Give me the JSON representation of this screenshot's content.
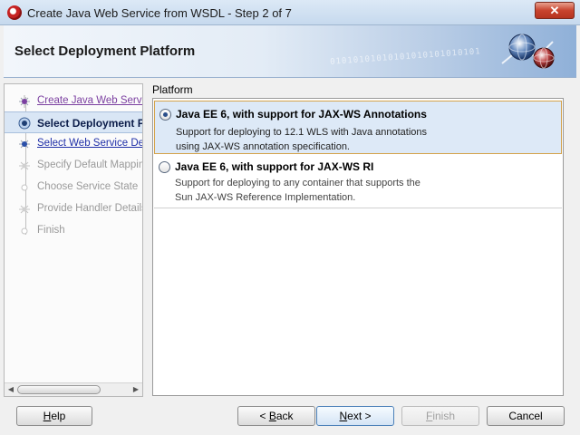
{
  "window": {
    "title": "Create Java Web Service from WSDL - Step 2 of 7",
    "close_label": "✕"
  },
  "header": {
    "title": "Select Deployment Platform",
    "binary_text": "01010101010101010101010101"
  },
  "steps": [
    {
      "label": "Create Java Web Servic",
      "state": "visited"
    },
    {
      "label": "Select Deployment P",
      "state": "current"
    },
    {
      "label": "Select Web Service Desc",
      "state": "link"
    },
    {
      "label": "Specify Default Mapping",
      "state": "disabled"
    },
    {
      "label": "Choose Service State",
      "state": "disabled"
    },
    {
      "label": "Provide Handler Details",
      "state": "disabled"
    },
    {
      "label": "Finish",
      "state": "disabled"
    }
  ],
  "platform": {
    "label": "Platform",
    "options": [
      {
        "title": "Java EE 6, with support for JAX-WS Annotations",
        "desc_line1": "Support for deploying to 12.1 WLS with Java annotations",
        "desc_line2": "using JAX-WS annotation specification.",
        "selected": true
      },
      {
        "title": "Java EE 6, with support for JAX-WS RI",
        "desc_line1": "Support for deploying to any container that supports the",
        "desc_line2": "Sun JAX-WS Reference Implementation.",
        "selected": false
      }
    ]
  },
  "buttons": {
    "help": {
      "pre": "",
      "mnemonic": "H",
      "post": "elp"
    },
    "back": {
      "pre": "< ",
      "mnemonic": "B",
      "post": "ack"
    },
    "next": {
      "pre": "",
      "mnemonic": "N",
      "post": "ext >"
    },
    "finish": {
      "pre": "",
      "mnemonic": "F",
      "post": "inish"
    },
    "cancel": {
      "label": "Cancel"
    }
  }
}
